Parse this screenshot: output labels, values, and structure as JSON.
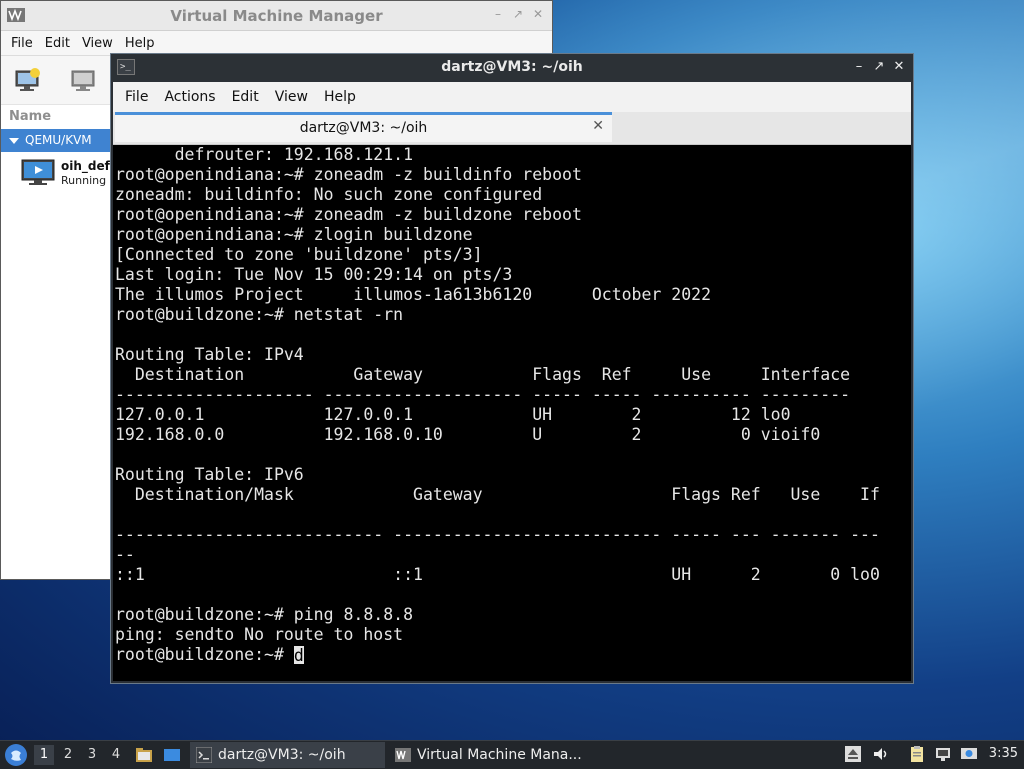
{
  "vmm": {
    "title": "Virtual Machine Manager",
    "menu": [
      "File",
      "Edit",
      "View",
      "Help"
    ],
    "column_header": "Name",
    "group": "QEMU/KVM",
    "vm": {
      "name": "oih_defa",
      "status": "Running"
    }
  },
  "terminal": {
    "title": "dartz@VM3: ~/oih",
    "menu": [
      "File",
      "Actions",
      "Edit",
      "View",
      "Help"
    ],
    "tab_label": "dartz@VM3: ~/oih",
    "lines": [
      "      defrouter: 192.168.121.1",
      "root@openindiana:~# zoneadm -z buildinfo reboot",
      "zoneadm: buildinfo: No such zone configured",
      "root@openindiana:~# zoneadm -z buildzone reboot",
      "root@openindiana:~# zlogin buildzone",
      "[Connected to zone 'buildzone' pts/3]",
      "Last login: Tue Nov 15 00:29:14 on pts/3",
      "The illumos Project     illumos-1a613b6120      October 2022",
      "root@buildzone:~# netstat -rn",
      "",
      "Routing Table: IPv4",
      "  Destination           Gateway           Flags  Ref     Use     Interface",
      "-------------------- -------------------- ----- ----- ---------- ---------",
      "127.0.0.1            127.0.0.1            UH        2         12 lo0",
      "192.168.0.0          192.168.0.10         U         2          0 vioif0",
      "",
      "Routing Table: IPv6",
      "  Destination/Mask            Gateway                   Flags Ref   Use    If",
      "",
      "--------------------------- --------------------------- ----- --- ------- ---",
      "--",
      "::1                         ::1                         UH      2       0 lo0",
      "",
      "root@buildzone:~# ping 8.8.8.8",
      "ping: sendto No route to host"
    ],
    "prompt": "root@buildzone:~# ",
    "input": "d"
  },
  "taskbar": {
    "workspaces": [
      "1",
      "2",
      "3",
      "4"
    ],
    "active_workspace": "1",
    "tasks": [
      {
        "label": "dartz@VM3: ~/oih",
        "icon": "terminal-icon"
      },
      {
        "label": "Virtual Machine Mana...",
        "icon": "vmm-icon"
      }
    ],
    "clock": "3:35"
  }
}
